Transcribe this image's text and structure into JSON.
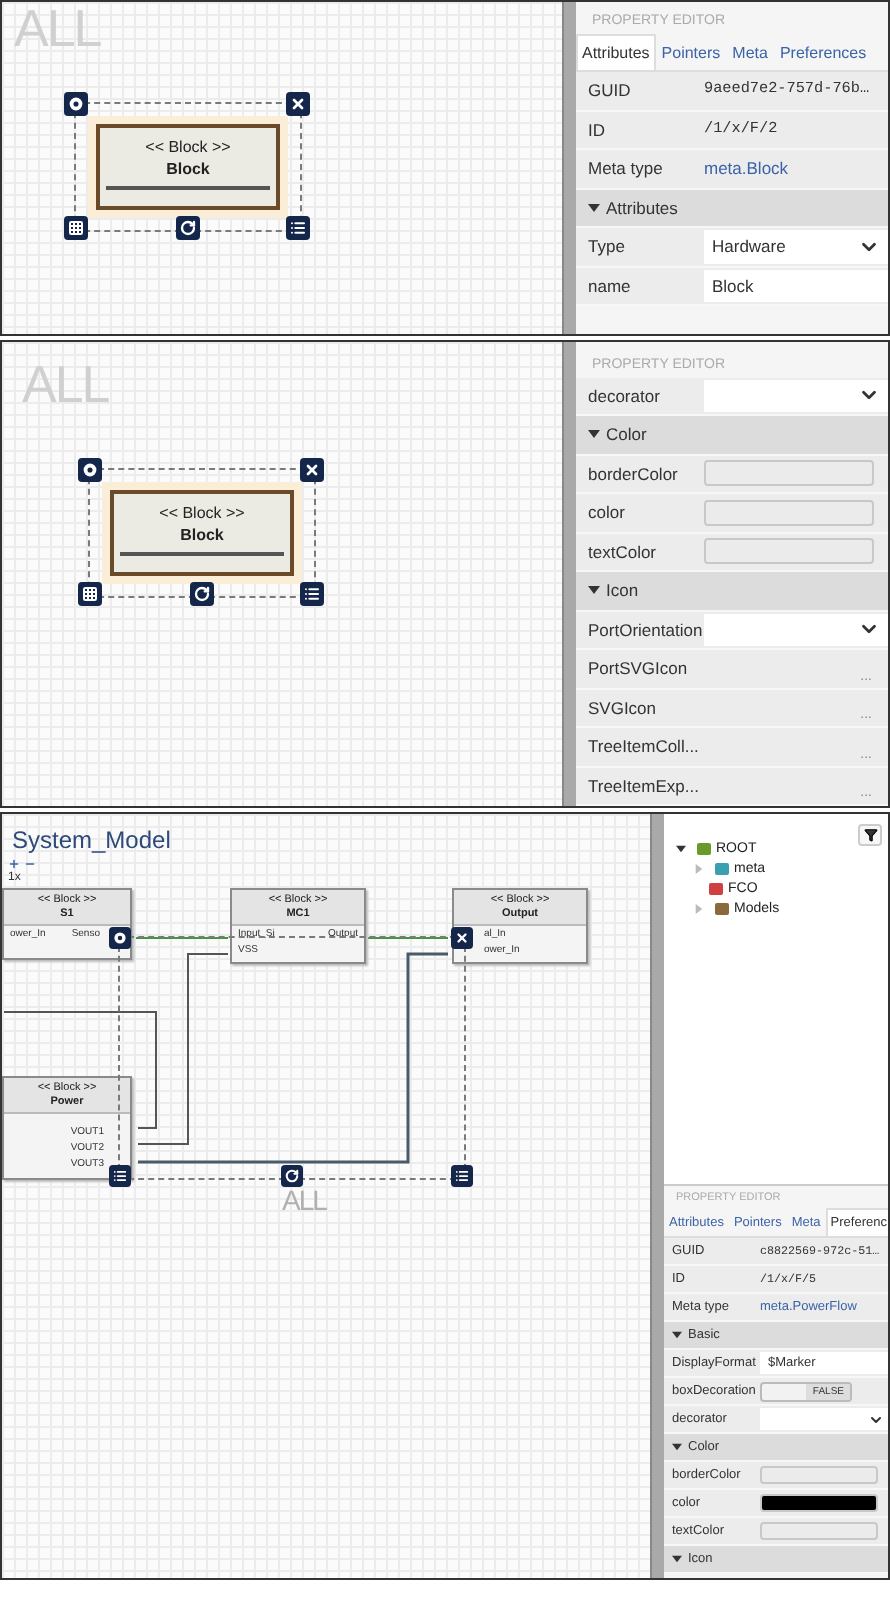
{
  "panels": [
    {
      "kind": "block",
      "canvas": {
        "watermark": "ALL",
        "block": {
          "stereotype": "<< Block >>",
          "name": "Block"
        }
      },
      "editor": {
        "heading": "PROPERTY EDITOR",
        "tabs": [
          {
            "label": "Attributes",
            "selected": true
          },
          {
            "label": "Pointers",
            "selected": false
          },
          {
            "label": "Meta",
            "selected": false
          },
          {
            "label": "Preferences",
            "selected": false
          }
        ],
        "rows": [
          {
            "kind": "info",
            "label": "GUID",
            "value": "9aeed7e2-757d-76b…"
          },
          {
            "kind": "info",
            "label": "ID",
            "value": "/1/x/F/2"
          },
          {
            "kind": "link",
            "label": "Meta type",
            "value": "meta.Block"
          },
          {
            "kind": "section",
            "label": "Attributes",
            "expanded": true
          },
          {
            "kind": "select",
            "label": "Type",
            "value": "Hardware"
          },
          {
            "kind": "text",
            "label": "name",
            "value": "Block"
          }
        ]
      }
    },
    {
      "kind": "block",
      "canvas": {
        "watermark": "ALL",
        "block": {
          "stereotype": "<< Block >>",
          "name": "Block"
        }
      },
      "editor": {
        "heading": "PROPERTY EDITOR",
        "rows": [
          {
            "kind": "select",
            "label": "decorator"
          },
          {
            "kind": "section",
            "label": "Color",
            "expanded": true
          },
          {
            "kind": "color",
            "label": "borderColor"
          },
          {
            "kind": "color",
            "label": "color"
          },
          {
            "kind": "color",
            "label": "textColor"
          },
          {
            "kind": "section",
            "label": "Icon",
            "expanded": true
          },
          {
            "kind": "select",
            "label": "PortOrientation"
          },
          {
            "kind": "asset",
            "label": "PortSVGIcon",
            "action": "..."
          },
          {
            "kind": "asset",
            "label": "SVGIcon",
            "action": "..."
          },
          {
            "kind": "asset",
            "label": "TreeItemColl...",
            "action": "..."
          },
          {
            "kind": "asset",
            "label": "TreeItemExp...",
            "action": "..."
          }
        ]
      }
    },
    {
      "kind": "model",
      "canvas": {
        "title": "System_Model",
        "zoom_label": "1x",
        "watermark": "ALL",
        "nodes": [
          {
            "stereotype": "<< Block >>",
            "name": "S1",
            "ports": [
              {
                "left": "ower_In",
                "right": "Senso"
              }
            ]
          },
          {
            "stereotype": "<< Block >>",
            "name": "MC1",
            "ports": [
              {
                "left": "Input_Si",
                "right": "Output"
              },
              {
                "left": "VSS"
              }
            ]
          },
          {
            "stereotype": "<< Block >>",
            "name": "Output",
            "ports": [
              {
                "left": "al_In"
              },
              {
                "left": "ower_In"
              }
            ]
          },
          {
            "stereotype": "<< Block >>",
            "name": "Power",
            "ports": [
              {
                "right": "VOUT1"
              },
              {
                "right": "VOUT2"
              },
              {
                "right": "VOUT3"
              }
            ]
          }
        ]
      },
      "tree": [
        {
          "label": "ROOT",
          "kind": "root",
          "expanded": true,
          "children": [
            {
              "label": "meta",
              "kind": "folder",
              "expanded": false
            },
            {
              "label": "FCO",
              "kind": "fco"
            },
            {
              "label": "Models",
              "kind": "models",
              "expanded": false
            }
          ]
        }
      ],
      "editor": {
        "heading": "PROPERTY EDITOR",
        "tabs": [
          {
            "label": "Attributes",
            "selected": false
          },
          {
            "label": "Pointers",
            "selected": false
          },
          {
            "label": "Meta",
            "selected": false
          },
          {
            "label": "Preferenc",
            "selected": true
          }
        ],
        "rows": [
          {
            "kind": "info",
            "label": "GUID",
            "value": "c8822569-972c-51…"
          },
          {
            "kind": "info",
            "label": "ID",
            "value": "/1/x/F/5"
          },
          {
            "kind": "link",
            "label": "Meta type",
            "value": "meta.PowerFlow"
          },
          {
            "kind": "section",
            "label": "Basic",
            "expanded": true
          },
          {
            "kind": "text",
            "label": "DisplayFormat",
            "value": "$Marker"
          },
          {
            "kind": "toggle",
            "label": "boxDecoration",
            "value": "FALSE",
            "on": false
          },
          {
            "kind": "select",
            "label": "decorator"
          },
          {
            "kind": "section",
            "label": "Color",
            "expanded": true
          },
          {
            "kind": "color",
            "label": "borderColor"
          },
          {
            "kind": "color",
            "label": "color",
            "color": "#000000"
          },
          {
            "kind": "color",
            "label": "textColor"
          },
          {
            "kind": "section",
            "label": "Icon",
            "expanded": true
          }
        ]
      }
    }
  ]
}
